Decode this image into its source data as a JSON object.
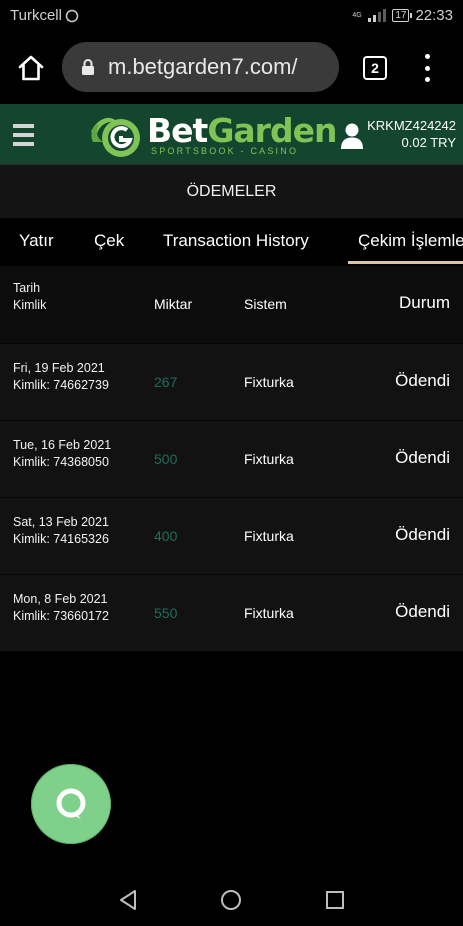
{
  "status_bar": {
    "carrier": "Turkcell",
    "network": "4G",
    "battery": "17",
    "time": "22:33"
  },
  "browser": {
    "url": "m.betgarden7.com/",
    "tab_count": "2"
  },
  "header": {
    "logo_bet": "Bet",
    "logo_garden": "Garden",
    "logo_tagline": "SPORTSBOOK - CASINO",
    "username": "KRKMZ424242",
    "balance": "0.02 TRY"
  },
  "page_title": "ÖDEMELER",
  "tabs": [
    {
      "label": "Yatır"
    },
    {
      "label": "Çek"
    },
    {
      "label": "Transaction History"
    },
    {
      "label": "Çekim İşlemleri",
      "active": true
    }
  ],
  "table": {
    "headers": {
      "date": "Tarih",
      "id": "Kimlik",
      "amount": "Miktar",
      "system": "Sistem",
      "status": "Durum"
    },
    "rows": [
      {
        "date": "Fri, 19 Feb 2021",
        "id": "Kimlik: 74662739",
        "amount": "267",
        "system": "Fixturka",
        "status": "Ödendi"
      },
      {
        "date": "Tue, 16 Feb 2021",
        "id": "Kimlik: 74368050",
        "amount": "500",
        "system": "Fixturka",
        "status": "Ödendi"
      },
      {
        "date": "Sat, 13 Feb 2021",
        "id": "Kimlik: 74165326",
        "amount": "400",
        "system": "Fixturka",
        "status": "Ödendi"
      },
      {
        "date": "Mon, 8 Feb 2021",
        "id": "Kimlik: 73660172",
        "amount": "550",
        "system": "Fixturka",
        "status": "Ödendi"
      }
    ]
  },
  "colors": {
    "header_bg": "#14452f",
    "brand_green": "#7fc455",
    "amount_text": "#1f6d5a",
    "fab": "#7fd08a",
    "tab_underline": "#d7c7a4"
  },
  "icons": {
    "whatsapp": "whatsapp-icon",
    "home": "home-icon",
    "lock": "lock-icon",
    "menu": "more-vert-icon",
    "hamburger": "hamburger-icon",
    "user": "user-icon",
    "chat": "chat-icon",
    "back": "back-icon",
    "nav_home": "nav-home-icon",
    "recents": "recents-icon"
  }
}
